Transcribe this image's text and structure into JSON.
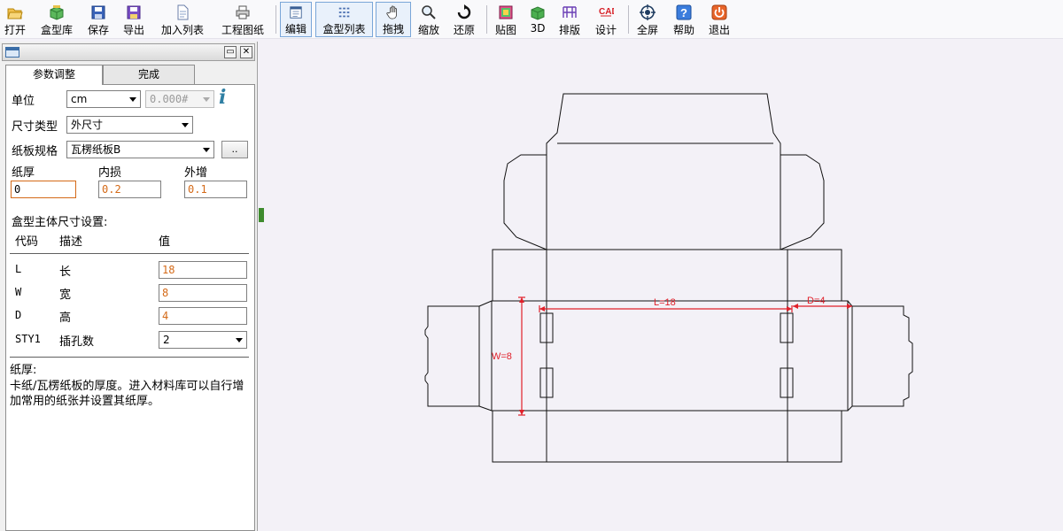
{
  "toolbar": {
    "open": "打开",
    "box_lib": "盒型库",
    "save": "保存",
    "export": "导出",
    "add_list": "加入列表",
    "eng_drawing": "工程图纸",
    "edit": "编辑",
    "box_list": "盒型列表",
    "drag": "拖拽",
    "zoom": "缩放",
    "restore": "还原",
    "texture": "贴图",
    "three_d": "3D",
    "layout": "排版",
    "design": "设计",
    "fullscreen": "全屏",
    "help": "帮助",
    "quit": "退出"
  },
  "panel": {
    "tabs": [
      "参数调整",
      "完成"
    ],
    "unit_label": "单位",
    "unit_value": "cm",
    "precision_value": "0.000#",
    "size_type_label": "尺寸类型",
    "size_type_value": "外尺寸",
    "board_label": "纸板规格",
    "board_value": "瓦楞纸板B",
    "board_more": "..",
    "thickness_label": "纸厚",
    "inner_loss_label": "内损",
    "outer_add_label": "外增",
    "thickness_value": "0",
    "inner_loss_value": "0.2",
    "outer_add_value": "0.1",
    "section_title": "盒型主体尺寸设置:",
    "col_code": "代码",
    "col_desc": "描述",
    "col_value": "值",
    "params": [
      {
        "code": "L",
        "desc": "长",
        "value": "18"
      },
      {
        "code": "W",
        "desc": "宽",
        "value": "8"
      },
      {
        "code": "D",
        "desc": "高",
        "value": "4"
      },
      {
        "code": "STY1",
        "desc": "插孔数",
        "value": "2"
      }
    ],
    "help_title": "纸厚:",
    "help_text": "卡纸/瓦楞纸板的厚度。进入材料库可以自行增加常用的纸张并设置其纸厚。"
  },
  "drawing": {
    "dim_l": "L=18",
    "dim_w": "W=8",
    "dim_d": "D=4",
    "dim_color": "#e0202a"
  }
}
